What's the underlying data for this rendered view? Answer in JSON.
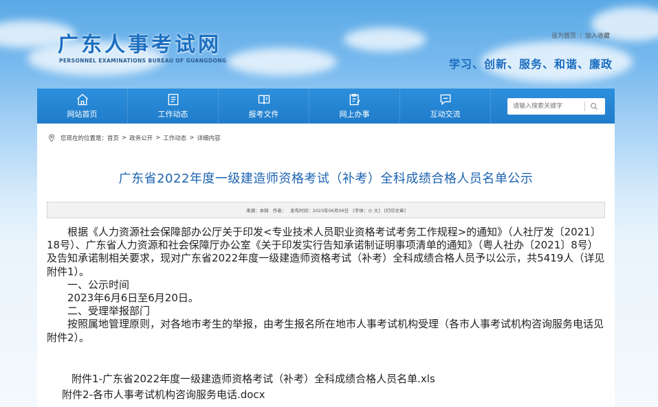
{
  "header": {
    "logo_title": "广东人事考试网",
    "logo_en": "PERSONNEL EXAMINATIONS BUREAU OF GUANGDONG",
    "top_links": [
      "设为首页",
      "加入收藏"
    ],
    "slogan": "学习、创新、服务、和谐、廉政"
  },
  "nav": {
    "items": [
      {
        "label": "网站首页",
        "icon": "home-icon"
      },
      {
        "label": "工作动态",
        "icon": "news-list-icon"
      },
      {
        "label": "报考文件",
        "icon": "book-icon"
      },
      {
        "label": "网上办事",
        "icon": "clipboard-edit-icon"
      },
      {
        "label": "互动交流",
        "icon": "chat-icon"
      }
    ],
    "search_placeholder": "请输入搜索关键字"
  },
  "breadcrumb": {
    "prefix": "您现在的位置是：",
    "items": [
      "首页",
      "政务公开",
      "工作动态",
      "详细内容"
    ],
    "separator": ">"
  },
  "article": {
    "title": "广东省2022年度一级建造师资格考试（补考）全科成绩合格人员名单公示",
    "meta": {
      "source": "来源：本网",
      "author": "作者：",
      "date": "发布时间：2023年06月06日",
      "font": "[字体：小 大]",
      "print": "[打印文章]"
    },
    "paragraphs": [
      "根据《人力资源社会保障部办公厅关于印发<专业技术人员职业资格考试考务工作规程>的通知》（人社厅发〔2021〕18号）、广东省人力资源和社会保障厅办公室《关于印发实行告知承诺制证明事项清单的通知》（粤人社办〔2021〕8号）及告知承诺制相关要求，现对广东省2022年度一级建造师资格考试（补考）全科成绩合格人员予以公示，共5419人（详见附件1）。",
      "一、公示时间",
      "2023年6月6日至6月20日。",
      "二、受理举报部门",
      "按照属地管理原则，对各地市考生的举报，由考生报名所在地市人事考试机构受理（各市人事考试机构咨询服务电话见附件2）。"
    ],
    "attachments": [
      "附件1-广东省2022年度一级建造师资格考试（补考）全科成绩合格人员名单.xls",
      "附件2-各市人事考试机构咨询服务电话.docx"
    ]
  },
  "colors": {
    "nav_bg": "#1f7cca",
    "title": "#1b63b1",
    "logo": "#1c6fc0"
  }
}
